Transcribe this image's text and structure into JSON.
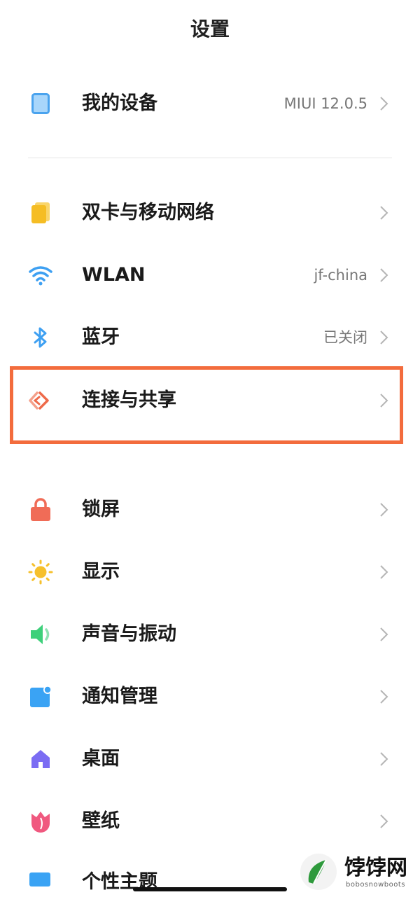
{
  "header": {
    "title": "设置"
  },
  "rows": [
    {
      "label": "我的设备",
      "value": "MIUI 12.0.5",
      "icon": "tablet-icon",
      "color": "#5aaef0"
    },
    {
      "label": "双卡与移动网络",
      "value": "",
      "icon": "sim-card-icon",
      "color": "#f5c02e"
    },
    {
      "label": "WLAN",
      "value": "jf-china",
      "icon": "wifi-icon",
      "color": "#3ea0f2"
    },
    {
      "label": "蓝牙",
      "value": "已关闭",
      "icon": "bluetooth-icon",
      "color": "#3ea0f2"
    },
    {
      "label": "连接与共享",
      "value": "",
      "icon": "connection-sharing-icon",
      "color": "#ee6a4a"
    },
    {
      "label": "锁屏",
      "value": "",
      "icon": "lock-icon",
      "color": "#f06c57"
    },
    {
      "label": "显示",
      "value": "",
      "icon": "sun-icon",
      "color": "#f6c02c"
    },
    {
      "label": "声音与振动",
      "value": "",
      "icon": "speaker-icon",
      "color": "#3dd07a"
    },
    {
      "label": "通知管理",
      "value": "",
      "icon": "notification-icon",
      "color": "#3aa3f4"
    },
    {
      "label": "桌面",
      "value": "",
      "icon": "home-icon",
      "color": "#7b6cf3"
    },
    {
      "label": "壁纸",
      "value": "",
      "icon": "tulip-icon",
      "color": "#f0587f"
    },
    {
      "label": "个性主题",
      "value": "",
      "icon": "theme-icon",
      "color": "#3aa3f4"
    }
  ],
  "highlight_color": "#f36c3d",
  "watermark": {
    "title": "饽饽网",
    "subtitle": "bobosnowboots"
  }
}
